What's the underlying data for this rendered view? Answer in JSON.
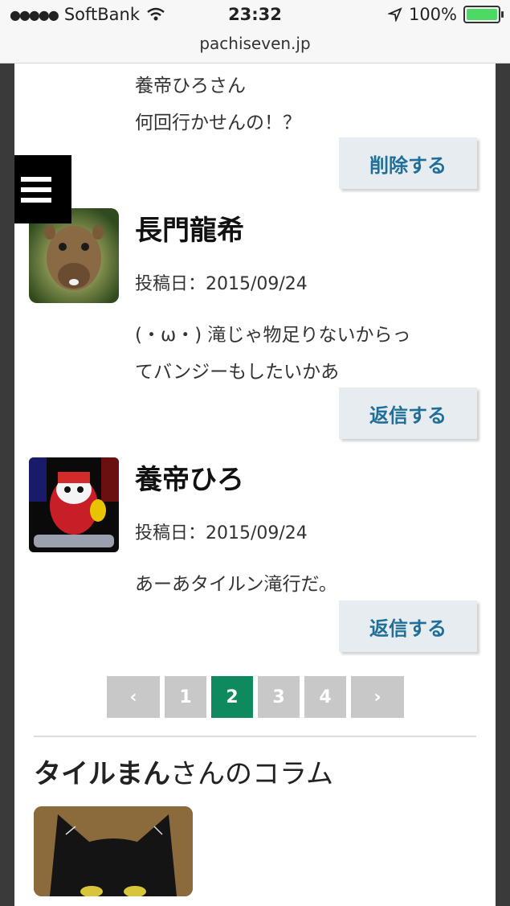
{
  "status": {
    "carrier": "SoftBank",
    "time": "23:32",
    "battery": "100%"
  },
  "url": "pachiseven.jp",
  "comments": [
    {
      "line1": "養帝ひろさん",
      "line2": "何回行かせんの！？",
      "button": "削除する"
    },
    {
      "name": "長門龍希",
      "date": "投稿日：2015/09/24",
      "line1": "(・ω・) 滝じゃ物足りないからっ",
      "line2": "てバンジーもしたいかあ",
      "button": "返信する"
    },
    {
      "name": "養帝ひろ",
      "date": "投稿日：2015/09/24",
      "line1": "あーあタイルン滝行だ。",
      "button": "返信する"
    }
  ],
  "pagination": {
    "prev": "‹",
    "pages": [
      "1",
      "2",
      "3",
      "4"
    ],
    "current": "2",
    "next": "›"
  },
  "column": {
    "author": "タイルまん",
    "suffix": "さんのコラム"
  }
}
